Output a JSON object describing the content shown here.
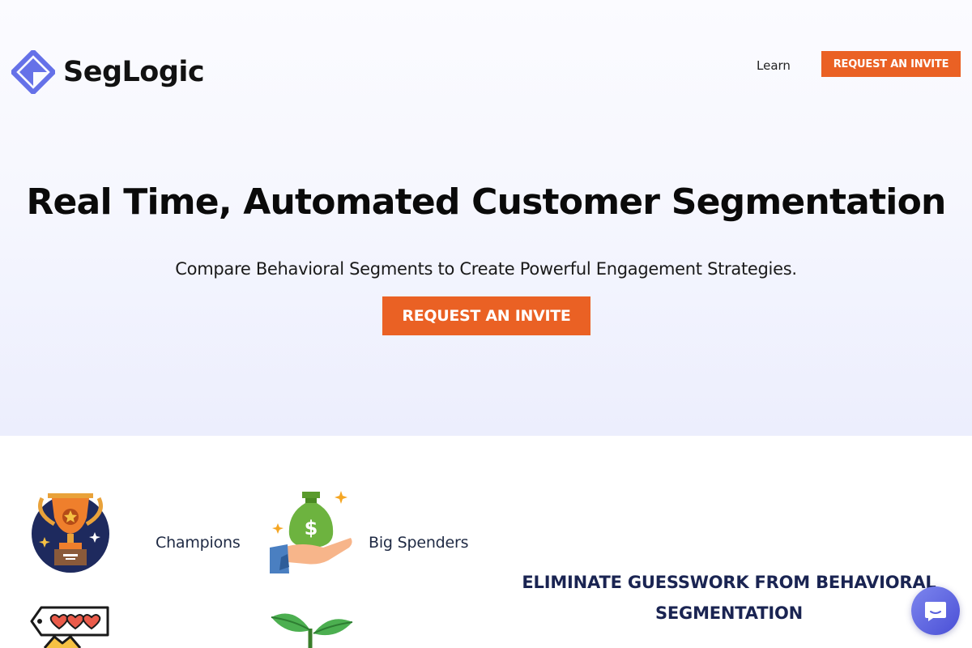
{
  "brand": {
    "name": "SegLogic",
    "accent": "#ea6124",
    "logo_color": "#6571e8"
  },
  "nav": {
    "learn": "Learn",
    "cta": "REQUEST AN INVITE"
  },
  "hero": {
    "title": "Real Time, Automated Customer Segmentation",
    "subtitle": "Compare Behavioral Segments to Create Powerful Engagement Strategies.",
    "cta": "REQUEST AN INVITE"
  },
  "segments": [
    {
      "label": "Champions",
      "icon": "trophy-icon"
    },
    {
      "label": "Big Spenders",
      "icon": "money-bag-hand-icon"
    },
    {
      "label": "",
      "icon": "hearts-ticket-icon"
    },
    {
      "label": "",
      "icon": "sprout-icon"
    }
  ],
  "feature": {
    "heading": "ELIMINATE GUESSWORK FROM BEHAVIORAL SEGMENTATION"
  },
  "chat": {
    "icon": "chat-bubble-icon"
  }
}
